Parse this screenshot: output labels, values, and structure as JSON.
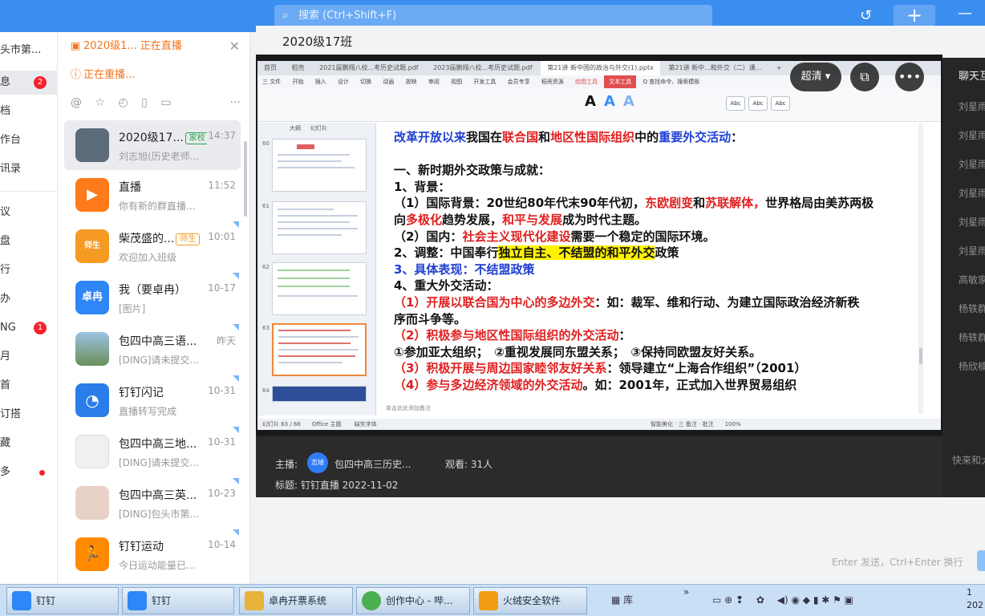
{
  "topbar": {
    "search_placeholder": "搜索 (Ctrl+Shift+F)",
    "plus_label": "+",
    "minimize_label": "—"
  },
  "leftnav": {
    "items": [
      {
        "label": "头市第...",
        "badge": ""
      },
      {
        "label": "息",
        "badge": "2"
      },
      {
        "label": "档",
        "badge": ""
      },
      {
        "label": "作台",
        "badge": ""
      },
      {
        "label": "讯录",
        "badge": ""
      },
      {
        "label": "议",
        "badge": ""
      },
      {
        "label": "盘",
        "badge": ""
      },
      {
        "label": "行",
        "badge": ""
      },
      {
        "label": "办",
        "badge": ""
      },
      {
        "label": "NG",
        "badge": "1"
      },
      {
        "label": "月",
        "badge": ""
      },
      {
        "label": "首",
        "badge": ""
      },
      {
        "label": "订搭",
        "badge": ""
      },
      {
        "label": "藏",
        "badge": ""
      },
      {
        "label": "多",
        "badge": "dot"
      }
    ]
  },
  "convlist": {
    "live_now": "2020级1... 正在直播",
    "replaying": "正在重播...",
    "more_label": "···",
    "conversations": [
      {
        "name": "2020级17...",
        "tag": "家校",
        "time": "14:37",
        "msg": "刘志旭(历史老师...",
        "avatar_text": "",
        "avatar_color": "#5b6b7a"
      },
      {
        "name": "直播",
        "tag": "",
        "time": "11:52",
        "msg": "你有新的群直播...",
        "avatar_text": "▶",
        "avatar_color": "#ff7a1a"
      },
      {
        "name": "柴茂盛的...",
        "tag": "师生",
        "time": "10:01",
        "msg": "欢迎加入班级",
        "avatar_text": "师生",
        "avatar_color": "#f59a23"
      },
      {
        "name": "我（要卓冉）",
        "tag": "",
        "time": "10-17",
        "msg": "[图片]",
        "avatar_text": "卓冉",
        "avatar_color": "#2f86f6"
      },
      {
        "name": "包四中高三语...",
        "tag": "",
        "time": "昨天",
        "msg": "[DING]请未提交...",
        "avatar_text": "",
        "avatar_color": "#6ea0c9"
      },
      {
        "name": "钉钉闪记",
        "tag": "",
        "time": "10-31",
        "msg": "直播转写完成",
        "avatar_text": "◔",
        "avatar_color": "#2b7de9"
      },
      {
        "name": "包四中高三地...",
        "tag": "",
        "time": "10-31",
        "msg": "[DING]请未提交...",
        "avatar_text": "",
        "avatar_color": "#e9e9e9"
      },
      {
        "name": "包四中高三英...",
        "tag": "",
        "time": "10-23",
        "msg": "[DING]包头市第...",
        "avatar_text": "",
        "avatar_color": "#d9c3b8"
      },
      {
        "name": "钉钉运动",
        "tag": "",
        "time": "10-14",
        "msg": "今日运动能量已...",
        "avatar_text": "🏃",
        "avatar_color": "#ff8a00"
      }
    ]
  },
  "main": {
    "title": "2020级17班",
    "quality_label": "超清",
    "host_label": "主播:",
    "host_avatar": "志旭",
    "host_name": "包四中高三历史...",
    "viewers_label": "观看: 31人",
    "subject_label": "标题: 钉钉直播 2022-11-02"
  },
  "ppt": {
    "tabs": [
      "首页",
      "稻壳",
      "2021届鹏翔八校...考历史试题.pdf",
      "2023届鹏翔八校...考历史试题.pdf",
      "第21讲 新中国的政治与外交(1).pptx",
      "第21讲 新中...和外交（二）课...",
      "+"
    ],
    "menu": [
      "三 文件",
      "开始",
      "插入",
      "设计",
      "切换",
      "动画",
      "放映",
      "审阅",
      "视图",
      "开发工具",
      "会员专享",
      "稻壳资源",
      "绘图工具",
      "文本工具",
      "Q 查找命令、搜索模板"
    ],
    "thumb_tabs": [
      "大纲",
      "幻灯片"
    ],
    "thumb_numbers": [
      "60",
      "61",
      "62",
      "63",
      "64"
    ],
    "slide_lines": [
      [
        {
          "t": "改革开放以来",
          "c": "blue"
        },
        {
          "t": "我国在",
          "c": ""
        },
        {
          "t": "联合国",
          "c": "red"
        },
        {
          "t": "和",
          "c": ""
        },
        {
          "t": "地区性国际组织",
          "c": "red"
        },
        {
          "t": "中的",
          "c": ""
        },
        {
          "t": "重要外交活动",
          "c": "blue"
        },
        {
          "t": "：",
          "c": ""
        }
      ],
      [],
      [
        {
          "t": "一、新时期外交政策与成就：",
          "c": ""
        }
      ],
      [
        {
          "t": "1、背景：",
          "c": ""
        }
      ],
      [
        {
          "t": "（1）国际背景：20世纪80年代末90年代初，",
          "c": ""
        },
        {
          "t": "东欧剧变",
          "c": "red"
        },
        {
          "t": "和",
          "c": ""
        },
        {
          "t": "苏联解体，",
          "c": "red"
        },
        {
          "t": "世界格局由美苏两极",
          "c": ""
        }
      ],
      [
        {
          "t": "向",
          "c": ""
        },
        {
          "t": "多极化",
          "c": "red"
        },
        {
          "t": "趋势发展，",
          "c": ""
        },
        {
          "t": "和平与发展",
          "c": "red"
        },
        {
          "t": "成为时代主题。",
          "c": ""
        }
      ],
      [
        {
          "t": "（2）国内：",
          "c": ""
        },
        {
          "t": "社会主义现代化建设",
          "c": "red"
        },
        {
          "t": "需要一个稳定的国际环境。",
          "c": ""
        }
      ],
      [
        {
          "t": "2、调整：中国奉行",
          "c": ""
        },
        {
          "t": "独立自主、不结盟的和平外交",
          "c": "hl"
        },
        {
          "t": "政策",
          "c": ""
        }
      ],
      [
        {
          "t": "3、具体表现：不结盟政策",
          "c": "blue"
        }
      ],
      [
        {
          "t": "4、重大外交活动：",
          "c": ""
        }
      ],
      [
        {
          "t": "（1）开展以联合国为中心的多边外交",
          "c": "red"
        },
        {
          "t": "：如：裁军、维和行动、为建立国际政治经济新秩",
          "c": ""
        }
      ],
      [
        {
          "t": "序而斗争等。",
          "c": ""
        }
      ],
      [
        {
          "t": "（2）积极参与地区性国际组织的外交活动",
          "c": "red"
        },
        {
          "t": "：",
          "c": ""
        }
      ],
      [
        {
          "t": "①参加亚太组织；　②重视发展同东盟关系；　③保持同欧盟友好关系。",
          "c": ""
        }
      ],
      [
        {
          "t": "（3）积极开展与周边国家睦邻友好关系",
          "c": "red"
        },
        {
          "t": "：领导建立“上海合作组织”（2001）",
          "c": ""
        }
      ],
      [
        {
          "t": "（4）参与多边经济领域的外交活动",
          "c": "red"
        },
        {
          "t": "。如：2001年，正式加入世界贸易组织",
          "c": ""
        }
      ]
    ],
    "note_placeholder": "单击此处添加备注",
    "status_left": "幻灯片 63 / 66　　Office 主题　　 缺失字体",
    "status_right": "智能美化 · 三 备注 · 批注　　100%"
  },
  "rpanel": {
    "header": "聊天互",
    "names": [
      "刘星雨",
      "刘星雨",
      "刘星雨",
      "刘星雨",
      "刘星雨",
      "刘星雨",
      "高敏家",
      "杨轶群",
      "杨轶群",
      "杨欣楠"
    ],
    "input_hint": "快来和大",
    "send_hint": "Enter 发送，Ctrl+Enter 换行"
  },
  "taskbar": {
    "items": [
      {
        "label": "钉钉",
        "color": "#2f86f6"
      },
      {
        "label": "钉钉",
        "color": "#2f86f6"
      },
      {
        "label": "卓冉开票系统",
        "color": "#e8b33a"
      },
      {
        "label": "创作中心 - 哔...",
        "color": "#4caf50"
      },
      {
        "label": "火绒安全软件",
        "color": "#f39c12"
      }
    ],
    "lib_label": "库",
    "time_line1": "1",
    "time_line2": "202"
  }
}
